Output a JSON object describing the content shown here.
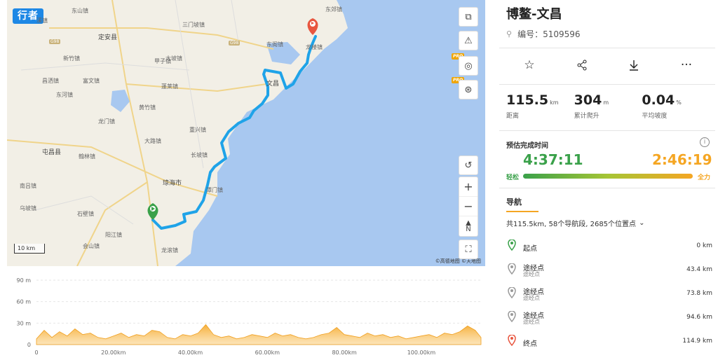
{
  "app": {
    "logo": "行者"
  },
  "map": {
    "labels": [
      {
        "text": "东山镇",
        "cls": ""
      },
      {
        "text": "溪镇",
        "cls": ""
      },
      {
        "text": "定安县",
        "cls": "big"
      },
      {
        "text": "新竹镇",
        "cls": ""
      },
      {
        "text": "富文镇",
        "cls": ""
      },
      {
        "text": "东河镇",
        "cls": ""
      },
      {
        "text": "龙门镇",
        "cls": ""
      },
      {
        "text": "屯昌县",
        "cls": "big"
      },
      {
        "text": "翰林镇",
        "cls": ""
      },
      {
        "text": "南吕镇",
        "cls": ""
      },
      {
        "text": "乌坡镇",
        "cls": ""
      },
      {
        "text": "石壁镇",
        "cls": ""
      },
      {
        "text": "阳江镇",
        "cls": ""
      },
      {
        "text": "会山镇",
        "cls": ""
      },
      {
        "text": "龙滚镇",
        "cls": ""
      },
      {
        "text": "琼海市",
        "cls": "big"
      },
      {
        "text": "长坡镇",
        "cls": ""
      },
      {
        "text": "潭门镇",
        "cls": ""
      },
      {
        "text": "大路镇",
        "cls": ""
      },
      {
        "text": "黄竹镇",
        "cls": ""
      },
      {
        "text": "重兴镇",
        "cls": ""
      },
      {
        "text": "蓬莱镇",
        "cls": ""
      },
      {
        "text": "大坡镇",
        "cls": ""
      },
      {
        "text": "三门坡镇",
        "cls": ""
      },
      {
        "text": "甲子镇",
        "cls": ""
      },
      {
        "text": "东阁镇",
        "cls": ""
      },
      {
        "text": "文昌",
        "cls": "big"
      },
      {
        "text": "东郊镇",
        "cls": ""
      },
      {
        "text": "龙楼镇",
        "cls": ""
      },
      {
        "text": "昌洒镇",
        "cls": ""
      },
      {
        "text": "G98",
        "cls": "road"
      },
      {
        "text": "G98",
        "cls": "road"
      }
    ],
    "scale": "10 km",
    "attribution": "©高德地图 ©天地图",
    "controls": {
      "layers": "layers-icon",
      "feedback": "feedback-icon",
      "globe": "globe-icon",
      "satellite": "satellite-icon",
      "pro": "PRO",
      "reset": "reset-icon",
      "zoom_in": "+",
      "zoom_out": "−",
      "compass": "N"
    }
  },
  "elevation": {
    "y_ticks": [
      "90 m",
      "60 m",
      "30 m",
      "0"
    ],
    "x_ticks": [
      "0",
      "20.00km",
      "40.00km",
      "60.00km",
      "80.00km",
      "100.00km"
    ],
    "y_max": 90,
    "x_max": 115.5,
    "profile_km": [
      0,
      2,
      4,
      6,
      8,
      10,
      12,
      14,
      16,
      18,
      20,
      22,
      24,
      26,
      28,
      30,
      32,
      34,
      36,
      38,
      40,
      42,
      44,
      46,
      48,
      50,
      52,
      54,
      56,
      58,
      60,
      62,
      64,
      66,
      68,
      70,
      72,
      74,
      76,
      78,
      80,
      82,
      84,
      86,
      88,
      90,
      92,
      94,
      96,
      98,
      100,
      102,
      104,
      106,
      108,
      110,
      112,
      114,
      115.5
    ],
    "profile_m": [
      8,
      20,
      10,
      18,
      12,
      22,
      14,
      16,
      10,
      8,
      12,
      16,
      10,
      14,
      12,
      20,
      18,
      10,
      8,
      14,
      12,
      16,
      28,
      14,
      10,
      12,
      8,
      10,
      14,
      12,
      10,
      16,
      12,
      14,
      10,
      8,
      10,
      14,
      16,
      24,
      14,
      12,
      10,
      16,
      12,
      14,
      10,
      12,
      8,
      10,
      12,
      14,
      10,
      16,
      14,
      18,
      26,
      20,
      10
    ]
  },
  "panel": {
    "title": "博鳌-文昌",
    "route_id": "编号：5109596",
    "actions": {
      "favorite": "star-icon",
      "share": "share-icon",
      "download": "download-icon",
      "more": "more-icon"
    },
    "stats": [
      {
        "value": "115.5",
        "unit": "km",
        "label": "距离"
      },
      {
        "value": "304",
        "unit": "m",
        "label": "累计爬升"
      },
      {
        "value": "0.04",
        "unit": "%",
        "label": "平均坡度"
      }
    ],
    "estimate": {
      "title": "预估完成时间",
      "fast": "4:37:11",
      "slow": "2:46:19",
      "easy_label": "轻松",
      "full_label": "全力"
    },
    "nav": {
      "title": "导航",
      "summary": "共115.5km, 58个导航段, 2685个位置点",
      "waypoints": [
        {
          "name": "起点",
          "sub": "",
          "dist": "0 km",
          "color": "#3aa14a"
        },
        {
          "name": "途经点",
          "sub": "途经点",
          "dist": "43.4 km",
          "color": "#9a9a9a"
        },
        {
          "name": "途经点",
          "sub": "途经点",
          "dist": "73.8 km",
          "color": "#9a9a9a"
        },
        {
          "name": "途经点",
          "sub": "途经点",
          "dist": "94.6 km",
          "color": "#9a9a9a"
        },
        {
          "name": "终点",
          "sub": "",
          "dist": "114.9 km",
          "color": "#e8563f"
        }
      ]
    }
  }
}
